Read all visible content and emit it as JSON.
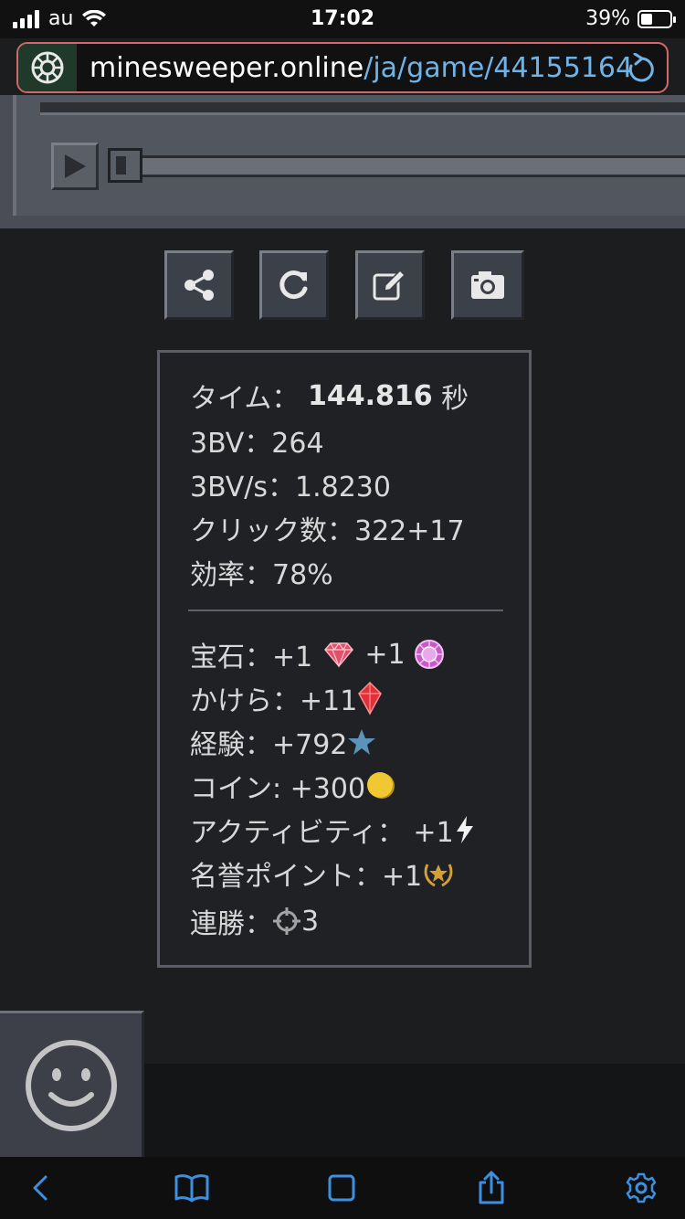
{
  "status_bar": {
    "carrier": "au",
    "time": "17:02",
    "battery": "39%",
    "battery_level": 0.39
  },
  "browser": {
    "url_host": "minesweeper.online",
    "url_path": "/ja/game/44155164"
  },
  "stats": {
    "time_label": "タイム：",
    "time_value": "144.816",
    "time_unit": "秒",
    "bv": "3BV：264",
    "bvs": "3BV/s：1.8230",
    "clicks": "クリック数：322+17",
    "efficiency": "効率：78%",
    "gems_label": "宝石：+1",
    "gems_value2": "+1",
    "shards": "かけら：+11",
    "experience": "経験：+792",
    "coins": "コイン: +300",
    "activity": "アクティビティ： +1",
    "honor": "名誉ポイント：+1",
    "streak_label": "連勝：",
    "streak_value": "3"
  },
  "icons": {
    "share": "share-icon",
    "replay": "replay-icon",
    "edit": "edit-icon",
    "camera": "camera-icon",
    "gem_red": "gem-red-icon",
    "gem_purple": "gem-purple-icon",
    "shard": "shard-icon",
    "star": "star-icon",
    "coin": "coin-icon",
    "bolt": "bolt-icon",
    "honor": "laurel-star-icon",
    "streak": "crosshair-icon",
    "smiley": "smiley-icon"
  },
  "colors": {
    "accent_blue": "#6fb4e8",
    "url_border": "#d06a6a",
    "star": "#5c93b8",
    "coin": "#f0c832",
    "gem_red": "#e0506a",
    "gem_purple": "#c75ac8"
  }
}
